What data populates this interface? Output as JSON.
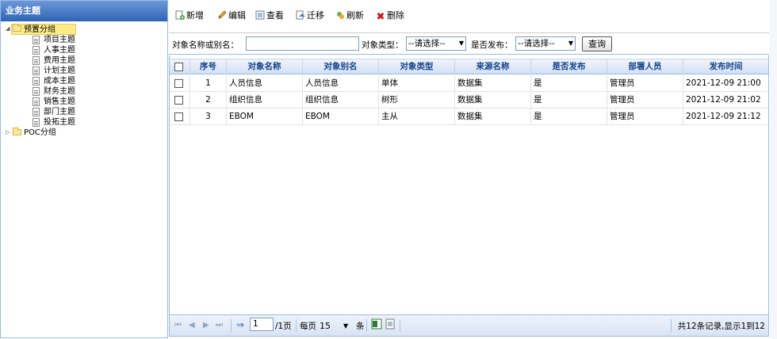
{
  "sidebar": {
    "title": "业务主题",
    "groups": [
      {
        "label": "预置分组",
        "expanded": true,
        "items": [
          "项目主题",
          "人事主题",
          "费用主题",
          "计划主题",
          "成本主题",
          "财务主题",
          "销售主题",
          "部门主题",
          "投拓主题"
        ]
      },
      {
        "label": "POC分组",
        "expanded": false
      }
    ]
  },
  "toolbar": {
    "add": "新增",
    "edit": "编辑",
    "view": "查看",
    "migrate": "迁移",
    "refresh": "刷新",
    "delete": "删除"
  },
  "search": {
    "name_label": "对象名称或别名：",
    "name_value": "",
    "type_label": "对象类型：",
    "type_value": "--请选择--",
    "publish_label": "是否发布：",
    "publish_value": "--请选择--",
    "query_button": "查询"
  },
  "grid": {
    "columns": [
      "序号",
      "对象名称",
      "对象别名",
      "对象类型",
      "来源名称",
      "是否发布",
      "部署人员",
      "发布时间"
    ],
    "rows": [
      {
        "no": "1",
        "name": "人员信息",
        "alias": "人员信息",
        "type": "单体",
        "source": "数据集",
        "published": "是",
        "deployer": "管理员",
        "time": "2021-12-09 21:00"
      },
      {
        "no": "2",
        "name": "组织信息",
        "alias": "组织信息",
        "type": "树形",
        "source": "数据集",
        "published": "是",
        "deployer": "管理员",
        "time": "2021-12-09 21:02"
      },
      {
        "no": "3",
        "name": "EBOM",
        "alias": "EBOM",
        "type": "主从",
        "source": "数据集",
        "published": "是",
        "deployer": "管理员",
        "time": "2021-12-09 21:12"
      }
    ]
  },
  "pager": {
    "page": "1",
    "total_pages": "/1页",
    "per_page_label": "每页",
    "per_page": "15",
    "unit": "条",
    "summary": "共12条记录,显示1到12"
  },
  "colors": {
    "accent": "#2e64b5",
    "border": "#99bbe8",
    "header_text": "#15428b",
    "selected": "#fbec88"
  }
}
